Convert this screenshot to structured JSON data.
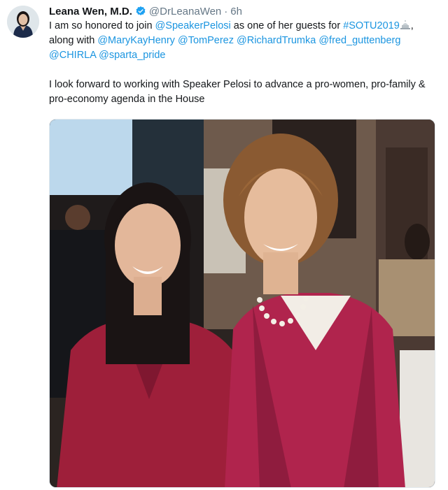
{
  "tweet": {
    "author": {
      "name": "Leana Wen, M.D.",
      "handle": "@DrLeanaWen",
      "separator": "·",
      "time": "6h",
      "verified_icon": "verified-badge-icon"
    },
    "text": {
      "line1_a": "I am so honored to join ",
      "mention_pelosi": "@SpeakerPelosi",
      "line1_b": " as one of her guests for ",
      "hashtag": "#SOTU2019",
      "emoji_icon": "capitol-building-icon",
      "line1_c": ",",
      "line2_a": "along with ",
      "mention_1": "@MaryKayHenry",
      "mention_2": "@TomPerez",
      "mention_3": "@RichardTrumka",
      "mention_4": "@fred_guttenberg",
      "mention_5": "@CHIRLA",
      "mention_6": "@sparta_pride",
      "paragraph2": "I look forward to working with Speaker Pelosi to advance a pro-women, pro-family & pro-economy agenda in the House"
    },
    "colors": {
      "link": "#1b95e0",
      "text": "#14171a",
      "secondary": "#657786",
      "verified": "#1da1f2"
    }
  }
}
